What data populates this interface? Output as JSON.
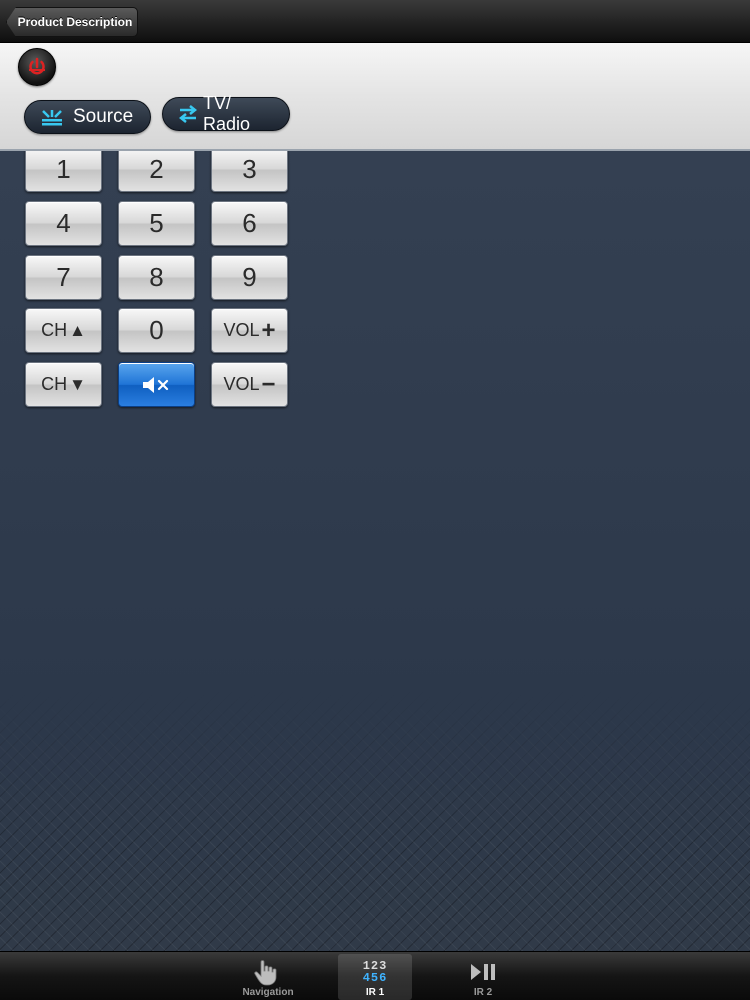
{
  "navbar": {
    "back_label": "Product Description"
  },
  "toolbar": {
    "source_label": "Source",
    "tvradio_label": "TV/ Radio"
  },
  "keypad": {
    "k1": "1",
    "k2": "2",
    "k3": "3",
    "k4": "4",
    "k5": "5",
    "k6": "6",
    "k7": "7",
    "k8": "8",
    "k9": "9",
    "k0": "0",
    "ch_label": "CH",
    "vol_label": "VOL"
  },
  "tabs": {
    "navigation": "Navigation",
    "ir1": "IR 1",
    "ir1_icon_line1": "123",
    "ir1_icon_line2": "456",
    "ir2": "IR 2"
  },
  "colors": {
    "accent_blue": "#1f74d6",
    "icon_cyan": "#38c8f0",
    "power_red": "#d22"
  }
}
